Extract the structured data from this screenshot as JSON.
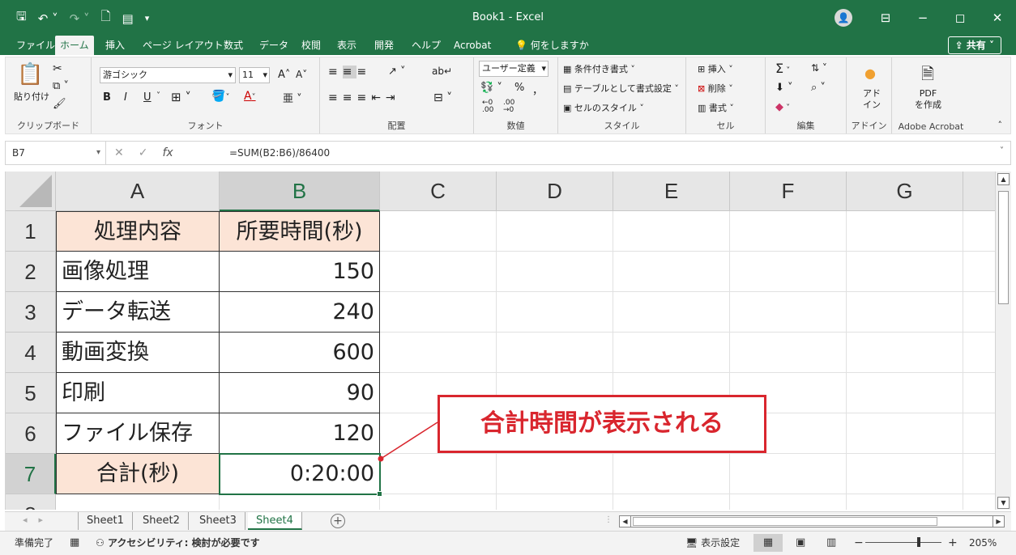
{
  "window": {
    "title": "Book1  -  Excel",
    "minimize": "−",
    "restore": "◻",
    "close": "✕",
    "ribbon_display": "⊟"
  },
  "tabs": [
    "ファイル",
    "ホーム",
    "挿入",
    "ページ レイアウト",
    "数式",
    "データ",
    "校閲",
    "表示",
    "開発",
    "ヘルプ",
    "Acrobat",
    "何をしますか"
  ],
  "share_label": "共有",
  "ribbon": {
    "clipboard": {
      "paste": "貼り付け",
      "group": "クリップボード"
    },
    "font": {
      "name": "游ゴシック",
      "size": "11",
      "bold": "B",
      "italic": "I",
      "underline": "U",
      "grow": "A",
      "shrink": "A",
      "group": "フォント"
    },
    "alignment": {
      "group": "配置"
    },
    "number": {
      "format": "ユーザー定義",
      "percent": "%",
      "comma": "，",
      "group": "数値"
    },
    "styles": {
      "conditional": "条件付き書式",
      "table": "テーブルとして書式設定",
      "cell_styles": "セルのスタイル",
      "group": "スタイル"
    },
    "cells": {
      "insert": "挿入",
      "delete": "削除",
      "format": "書式",
      "group": "セル"
    },
    "editing": {
      "sum": "Σ",
      "group": "編集"
    },
    "addins": {
      "label1": "アド",
      "label2": "イン",
      "group": "アドイン"
    },
    "acrobat": {
      "label1": "PDF",
      "label2": "を作成",
      "group": "Adobe Acrobat"
    }
  },
  "formula_bar": {
    "name_box": "B7",
    "cancel": "✕",
    "enter": "✓",
    "fx": "fx",
    "formula": "=SUM(B2:B6)/86400"
  },
  "columns": [
    "A",
    "B",
    "C",
    "D",
    "E",
    "F",
    "G"
  ],
  "rows": [
    "1",
    "2",
    "3",
    "4",
    "5",
    "6",
    "7",
    "8"
  ],
  "cells": {
    "A1": "処理内容",
    "B1": "所要時間(秒)",
    "A2": "画像処理",
    "B2": "150",
    "A3": "データ転送",
    "B3": "240",
    "A4": "動画変換",
    "B4": "600",
    "A5": "印刷",
    "B5": "90",
    "A6": "ファイル保存",
    "B6": "120",
    "A7": "合計(秒)",
    "B7": "0:20:00"
  },
  "sheets": [
    "Sheet1",
    "Sheet2",
    "Sheet3",
    "Sheet4"
  ],
  "active_sheet": "Sheet4",
  "status": {
    "ready": "準備完了",
    "accessibility": "アクセシビリティ: 検討が必要です",
    "display_settings": "表示設定",
    "zoom": "205%"
  },
  "callout": "合計時間が表示される",
  "colors": {
    "excel_green": "#217346",
    "header_fill": "#fce4d6",
    "callout_red": "#d9262e"
  }
}
